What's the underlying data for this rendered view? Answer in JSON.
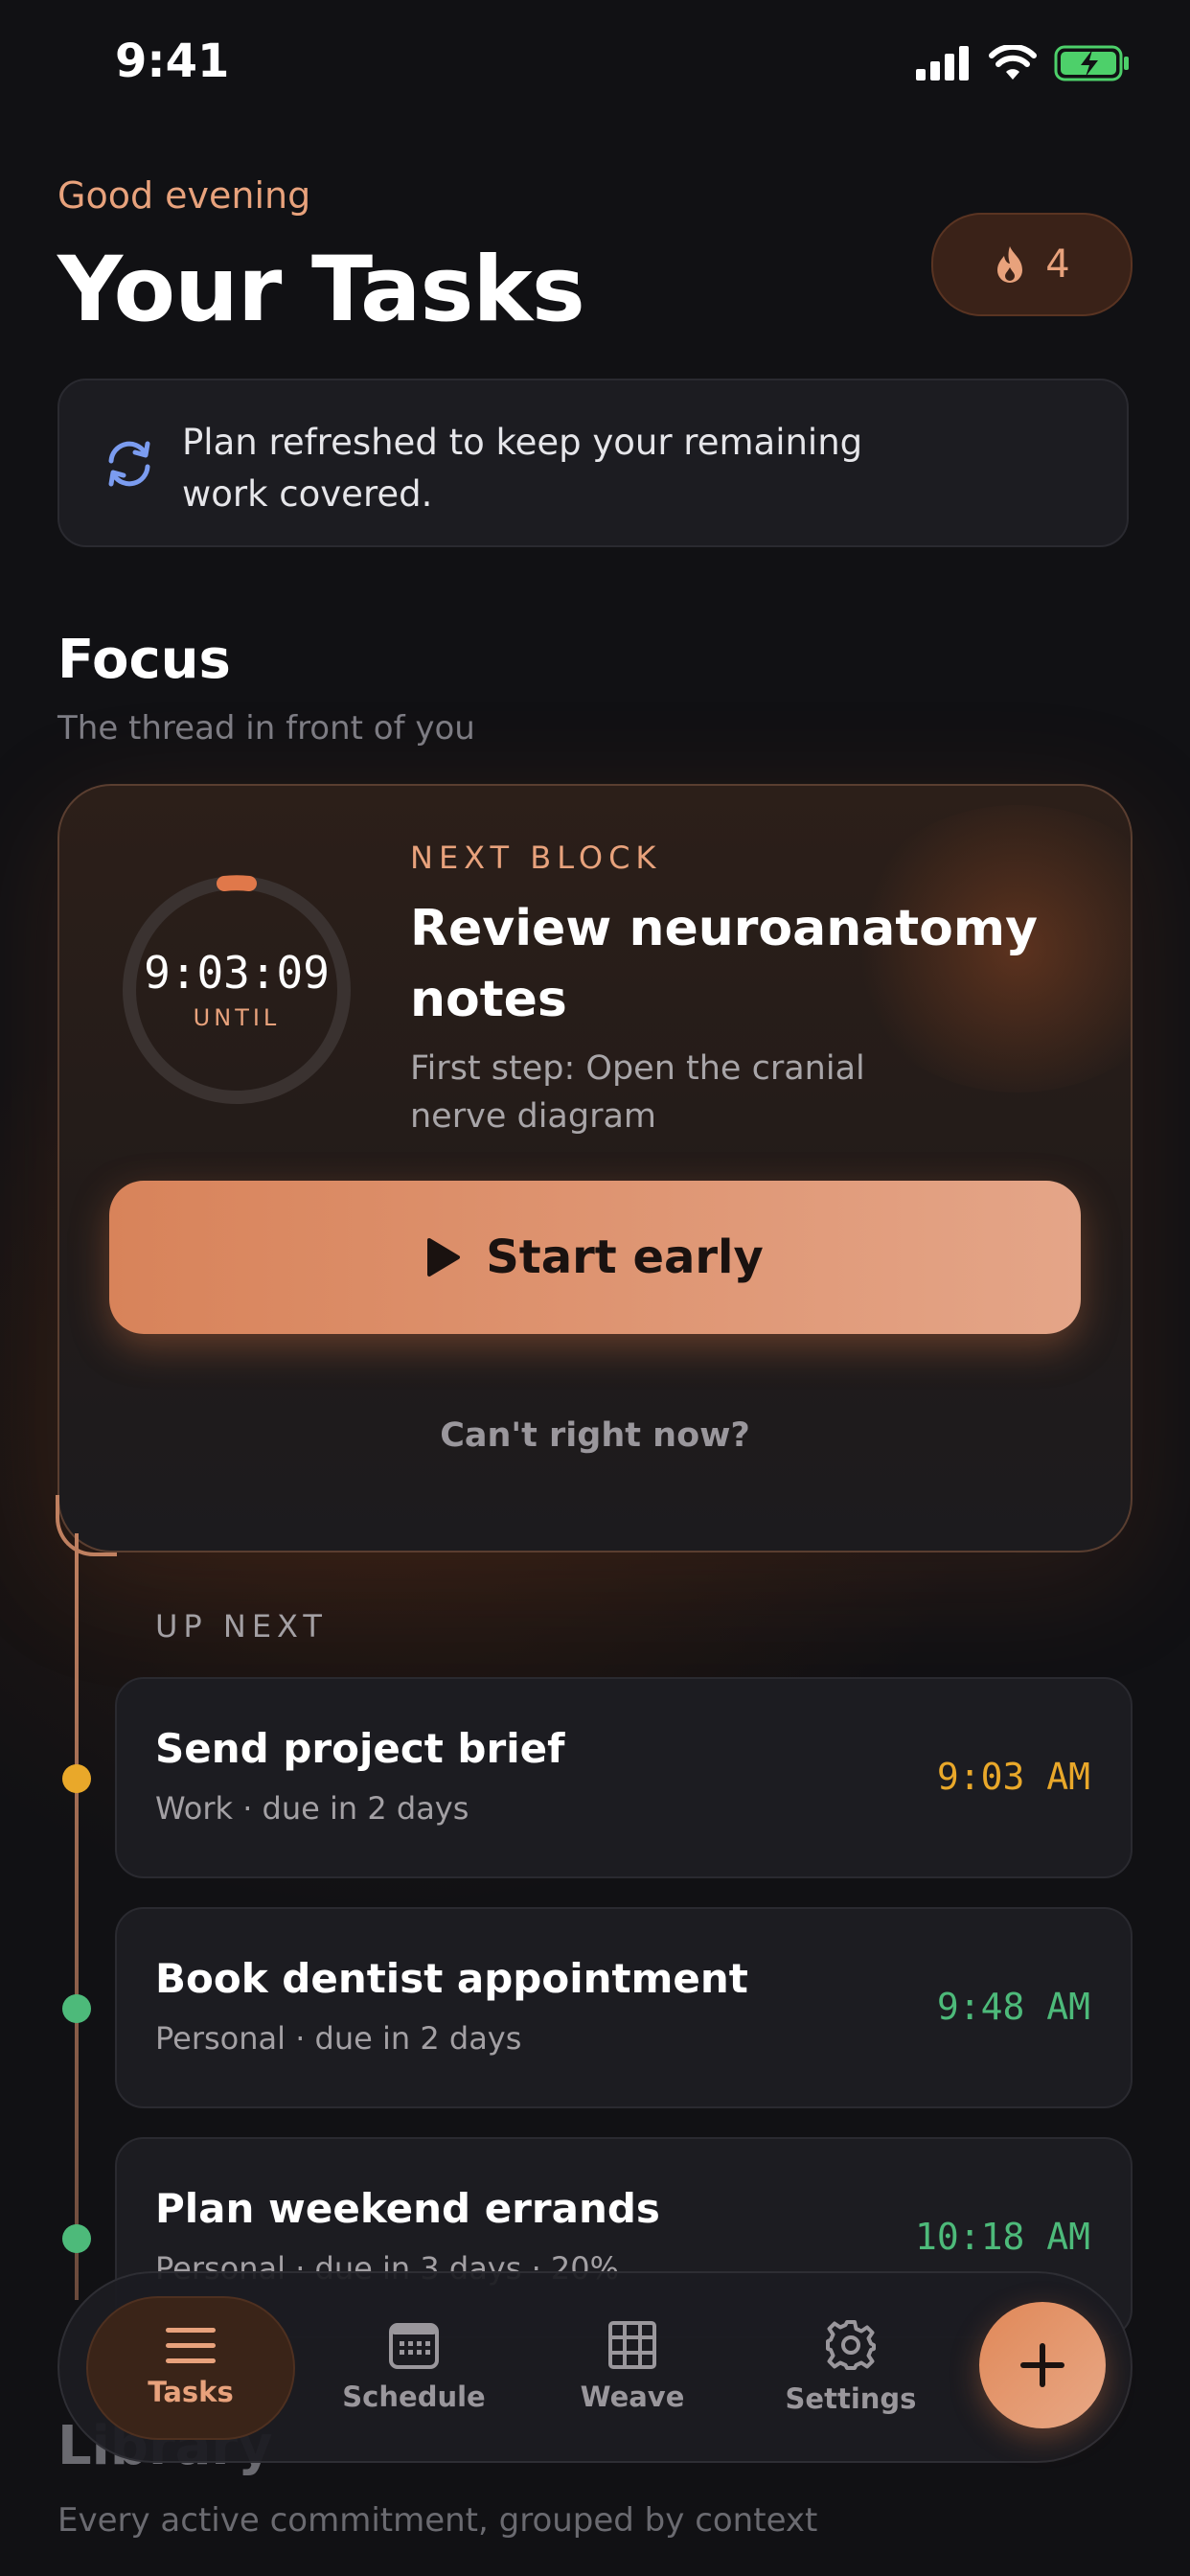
{
  "status_bar": {
    "time": "9:41"
  },
  "header": {
    "greeting": "Good evening",
    "title": "Your Tasks",
    "streak_count": "4"
  },
  "notice": {
    "text": "Plan refreshed to keep your remaining work covered."
  },
  "focus": {
    "title": "Focus",
    "subtitle": "The thread in front of you",
    "countdown": "9:03:09",
    "countdown_label": "UNTIL",
    "next_label": "NEXT BLOCK",
    "task_title": "Review neuroanatomy notes",
    "first_step": "First step: Open the cranial nerve diagram",
    "start_label": "Start early",
    "cant_label": "Can't right now?"
  },
  "up_next": {
    "label": "UP NEXT",
    "items": [
      {
        "title": "Send project brief",
        "meta": "Work · due in 2 days",
        "time": "9:03 AM",
        "color": "#e9a82a"
      },
      {
        "title": "Book dentist appointment",
        "meta": "Personal · due in 2 days",
        "time": "9:48 AM",
        "color": "#4dba7a"
      },
      {
        "title": "Plan weekend errands",
        "meta": "Personal · due in 3 days · 20%",
        "time": "10:18 AM",
        "color": "#4dba7a"
      }
    ]
  },
  "library": {
    "title": "Library",
    "subtitle": "Every active commitment, grouped by context"
  },
  "nav": {
    "items": [
      {
        "label": "Tasks",
        "icon": "menu-icon",
        "active": true
      },
      {
        "label": "Schedule",
        "icon": "calendar-icon",
        "active": false
      },
      {
        "label": "Weave",
        "icon": "grid-icon",
        "active": false
      },
      {
        "label": "Settings",
        "icon": "gear-icon",
        "active": false
      }
    ],
    "fab_icon": "plus-icon"
  },
  "colors": {
    "accent": "#e8a27c",
    "background": "#111114",
    "card": "#1c1c21"
  }
}
